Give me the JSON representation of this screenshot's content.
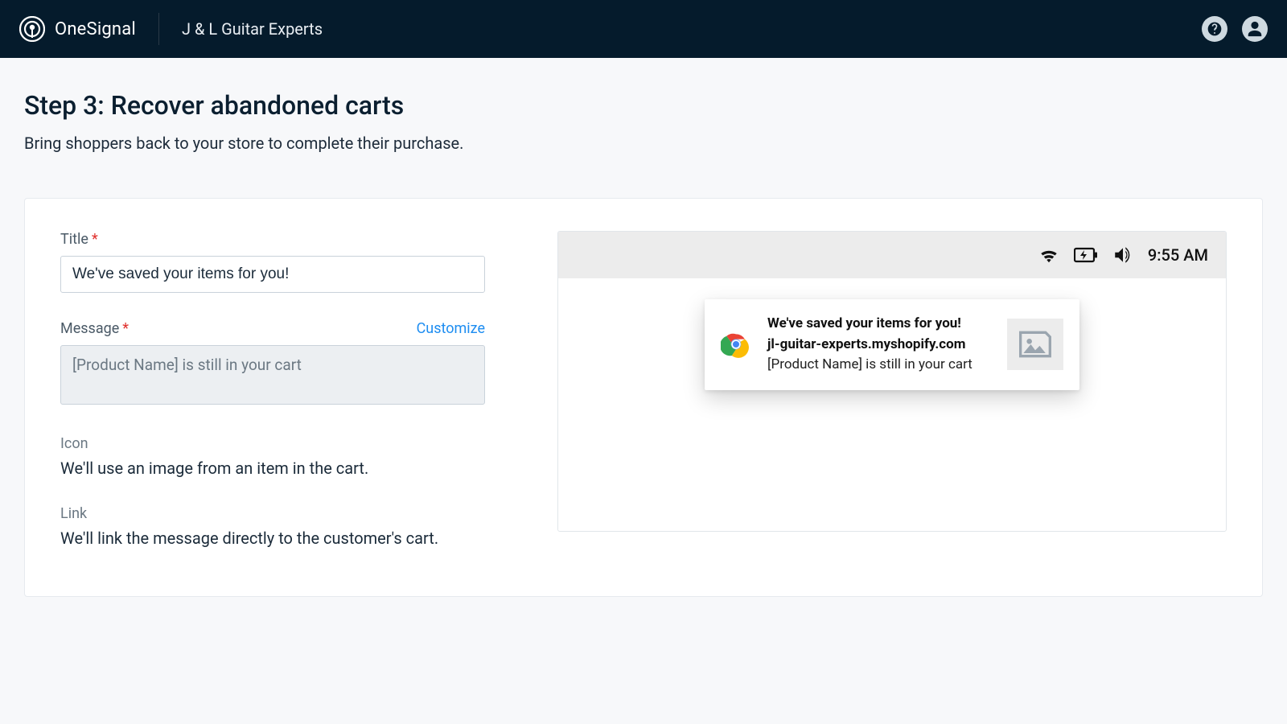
{
  "header": {
    "brand": "OneSignal",
    "app_name": "J & L Guitar Experts"
  },
  "page": {
    "heading": "Step 3: Recover abandoned carts",
    "subtitle": "Bring shoppers back to your store to complete their purchase."
  },
  "form": {
    "title": {
      "label": "Title",
      "value": "We've saved your items for you!"
    },
    "message": {
      "label": "Message",
      "customize_link": "Customize",
      "value": "[Product Name] is still in your cart"
    },
    "icon": {
      "label": "Icon",
      "text": "We'll use an image from an item in the cart."
    },
    "link": {
      "label": "Link",
      "text": "We'll link the message directly to the customer's cart."
    }
  },
  "preview": {
    "status_time": "9:55 AM",
    "notif_title": "We've saved your items for you!",
    "notif_domain": "jl-guitar-experts.myshopify.com",
    "notif_message": "[Product Name] is still in your cart"
  }
}
